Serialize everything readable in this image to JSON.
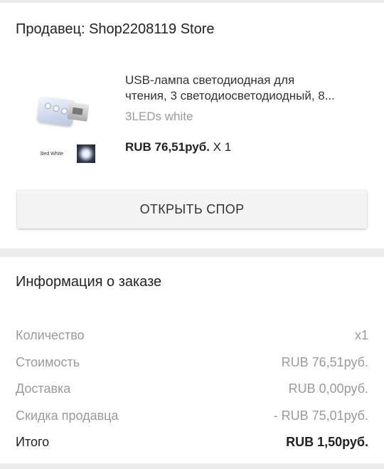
{
  "seller": {
    "label": "Продавец: Shop2208119 Store"
  },
  "product": {
    "image_caption": "3led White",
    "title_line1": "USB-лампа светодиодная для",
    "title_line2": "чтения, 3 светодиосветодиодный, 8...",
    "variant": "3LEDs white",
    "price": "RUB 76,51руб.",
    "quantity": "X 1"
  },
  "dispute_button": "ОТКРЫТЬ СПОР",
  "order_info": {
    "title": "Информация о заказе",
    "rows": [
      {
        "label": "Количество",
        "value": "x1"
      },
      {
        "label": "Стоимость",
        "value": "RUB 76,51руб."
      },
      {
        "label": "Доставка",
        "value": "RUB 0,00руб."
      },
      {
        "label": "Скидка продавца",
        "value": "- RUB 75,01руб."
      },
      {
        "label": "Итого",
        "value": "RUB 1,50руб."
      }
    ]
  }
}
